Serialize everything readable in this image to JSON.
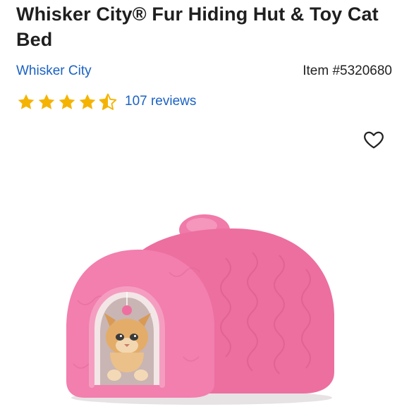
{
  "product": {
    "title": "Whisker City® Fur Hiding Hut & Toy Cat Bed",
    "brand": "Whisker City",
    "item_number": "Item #5320680",
    "rating": 4.5,
    "rating_max": 5,
    "reviews_label": "107 reviews"
  },
  "icons": {
    "star": "star-icon",
    "favorite": "heart-outline-icon"
  },
  "colors": {
    "star": "#f5b301",
    "link": "#1a62c4",
    "bed_pink": "#f27fae"
  }
}
